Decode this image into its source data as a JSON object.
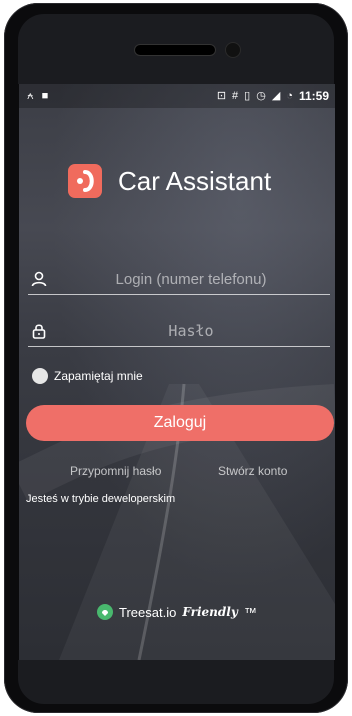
{
  "status_bar": {
    "left_icons": [
      "notification-icon",
      "cat-icon"
    ],
    "right_icons": [
      "cast-icon",
      "hash-icon",
      "vibrate-icon",
      "alarm-icon",
      "signal-icon",
      "clock-icon"
    ],
    "time": "11:59"
  },
  "app": {
    "title": "Car Assistant",
    "accent": "#f06b5d"
  },
  "login": {
    "login_placeholder": "Login (numer telefonu)",
    "password_placeholder": "Hasło",
    "remember_label": "Zapamiętaj mnie",
    "login_button": "Zaloguj",
    "remind_password": "Przypomnij hasło",
    "create_account": "Stwórz konto",
    "developer_note": "Jesteś w trybie deweloperskim"
  },
  "footer": {
    "brand_text": "Treesat.io",
    "brand_italic": "Friendly",
    "trademark": "™"
  }
}
